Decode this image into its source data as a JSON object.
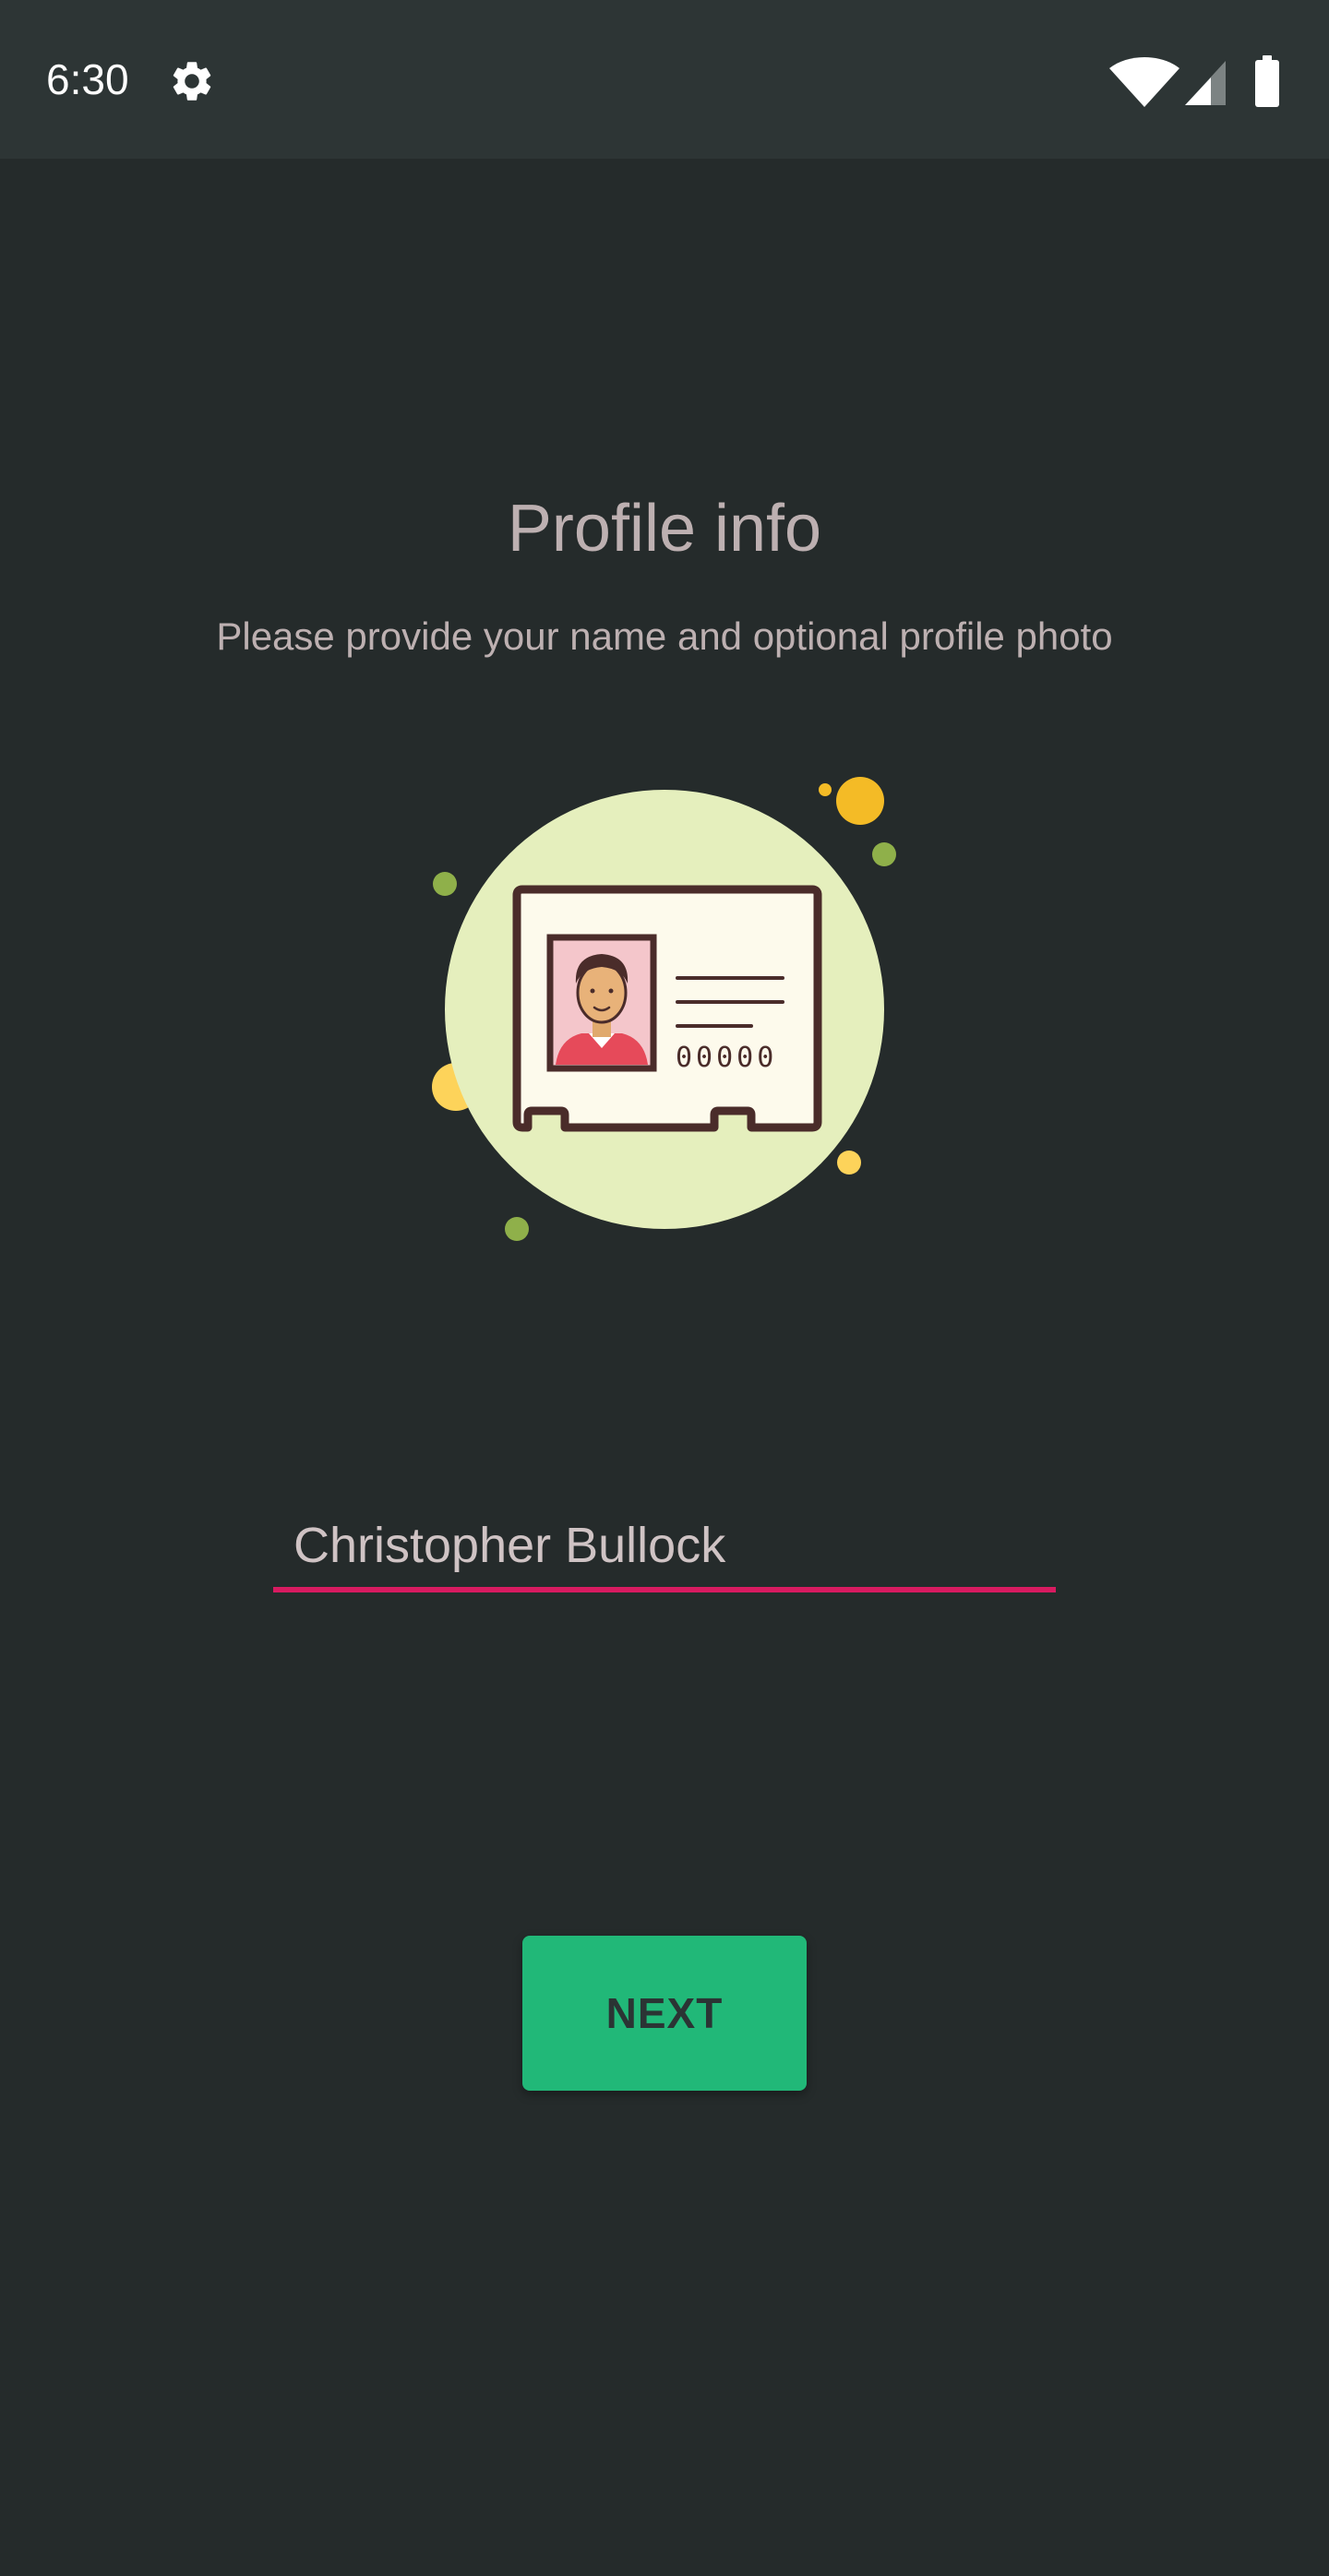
{
  "status_bar": {
    "time": "6:30",
    "icons": [
      "gear-icon",
      "wifi-icon",
      "cell-signal-icon",
      "battery-icon"
    ]
  },
  "header": {
    "title": "Profile info",
    "subtitle": "Please provide your name and optional profile photo"
  },
  "illustration": {
    "icon": "id-card-icon",
    "digits": "00000"
  },
  "form": {
    "name_value": "Christopher Bullock"
  },
  "actions": {
    "next_label": "NEXT"
  },
  "colors": {
    "background": "#252b2b",
    "status_bar": "#2d3535",
    "text_muted": "#bdb0b1",
    "accent_underline": "#d81b60",
    "button": "#21b878",
    "illustration_bg": "#e5efbd"
  }
}
